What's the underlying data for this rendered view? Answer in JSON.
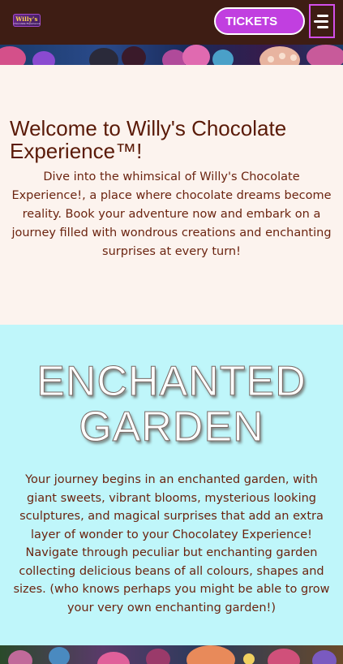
{
  "header": {
    "logo_title": "Willy's",
    "logo_subtitle": "Chocolate Experience",
    "tickets_label": "TICKETS",
    "colors": {
      "background": "#3e1d14",
      "button": "#c13fe0",
      "menu_border": "#d34fea"
    }
  },
  "icons": {
    "menu": "hamburger-menu-icon"
  },
  "welcome": {
    "title": "Welcome to Willy's Chocolate Experience™!",
    "body": "Dive into the whimsical of Willy's Chocolate Experience!, a place where chocolate dreams become reality. Book your adventure now and embark on a journey filled with wondrous creations and enchanting surprises at every turn!",
    "colors": {
      "background": "#fcf3ee",
      "text": "#5a1a08"
    }
  },
  "garden": {
    "title": "ENCHANTED GARDEN",
    "body": "Your journey begins in an enchanted garden, with giant  sweets, vibrant blooms, mysterious looking sculptures, and magical surprises that add an extra layer of wonder to your  Chocolatey Experience! Navigate through peculiar but enchanting garden collecting delicious beans of all colours, shapes  and sizes.  (who knows perhaps you might be able to grow your very own enchanting garden!)",
    "colors": {
      "background": "#bff6fa"
    }
  }
}
